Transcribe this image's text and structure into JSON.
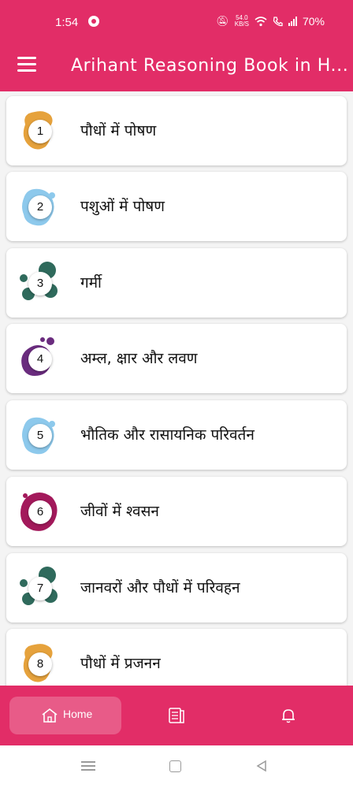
{
  "status_bar": {
    "time": "1:54",
    "net_speed_value": "54.0",
    "net_speed_unit": "KB/S",
    "battery": "70%"
  },
  "app_bar": {
    "title": "Arihant Reasoning Book in H..."
  },
  "chapters": [
    {
      "number": "1",
      "title": "पौधों में पोषण",
      "color": "#e6a23c",
      "shape": "splash-a"
    },
    {
      "number": "2",
      "title": "पशुओं में पोषण",
      "color": "#8dc9ec",
      "shape": "splash-b"
    },
    {
      "number": "3",
      "title": "गर्मी",
      "color": "#2f6a5c",
      "shape": "splash-c"
    },
    {
      "number": "4",
      "title": "अम्ल, क्षार और लवण",
      "color": "#6a2c7e",
      "shape": "splash-d"
    },
    {
      "number": "5",
      "title": "भौतिक और रासायनिक परिवर्तन",
      "color": "#8dc9ec",
      "shape": "splash-b"
    },
    {
      "number": "6",
      "title": "जीवों में श्वसन",
      "color": "#a3195b",
      "shape": "splash-e"
    },
    {
      "number": "7",
      "title": "जानवरों और पौधों में परिवहन",
      "color": "#2f6a5c",
      "shape": "splash-c"
    },
    {
      "number": "8",
      "title": "पौधों में प्रजनन",
      "color": "#e6a23c",
      "shape": "splash-a"
    }
  ],
  "bottom_nav": {
    "home_label": "Home"
  },
  "colors": {
    "primary": "#e22d67",
    "nav_highlight": "rgba(255,255,255,0.22)"
  },
  "icons": {
    "menu": "hamburger-icon",
    "home": "home-icon",
    "list": "book-list-icon",
    "notifications": "bell-icon"
  }
}
